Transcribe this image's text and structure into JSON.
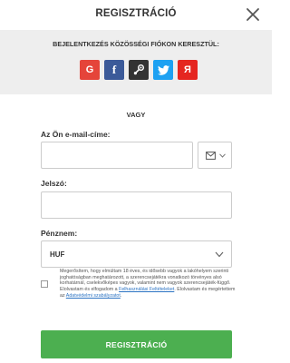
{
  "header": {
    "title": "REGISZTRÁCIÓ"
  },
  "social": {
    "title": "BEJELENTKEZÉS KÖZÖSSÉGI FIÓKON KERESZTÜL:",
    "providers": [
      {
        "name": "Google",
        "glyph": "G",
        "color": "#e5443a",
        "icon": "google-icon"
      },
      {
        "name": "Facebook",
        "glyph": "f",
        "color": "#3b5a99",
        "icon": "facebook-icon"
      },
      {
        "name": "Steam",
        "glyph": "",
        "color": "#333333",
        "icon": "steam-icon"
      },
      {
        "name": "Twitter",
        "glyph": "",
        "color": "#1da1f2",
        "icon": "twitter-icon"
      },
      {
        "name": "Yandex",
        "glyph": "Я",
        "color": "#e52620",
        "icon": "yandex-icon"
      }
    ]
  },
  "divider": {
    "label": "VAGY"
  },
  "form": {
    "email_label": "Az Ön e-mail-címe:",
    "email_value": "",
    "password_label": "Jelszó:",
    "password_value": "",
    "currency_label": "Pénznem:",
    "currency_value": "HUF"
  },
  "consent": {
    "text_part1": "Megerősítem, hogy elmúltam 18 éves, és idősebb vagyok a lakóhelyem szerinti joghatóságban meghatározott, a szerencsejátékra vonatkozó törvényes alsó korhatárnál, cselekvőképes vagyok, valamint nem vagyok szerencsejáték-függő. Elolvastam és elfogadom a ",
    "terms_link": "Felhasználási Feltételeket",
    "text_part2": ". Elolvastam és megértettem az ",
    "privacy_link": "Adatvédelmi szabályzatot",
    "text_part3": "."
  },
  "submit": {
    "label": "REGISZTRÁCIÓ"
  },
  "colors": {
    "accent_green": "#4caf50",
    "link_blue": "#2b73c3",
    "panel_gray": "#eeeeee"
  }
}
